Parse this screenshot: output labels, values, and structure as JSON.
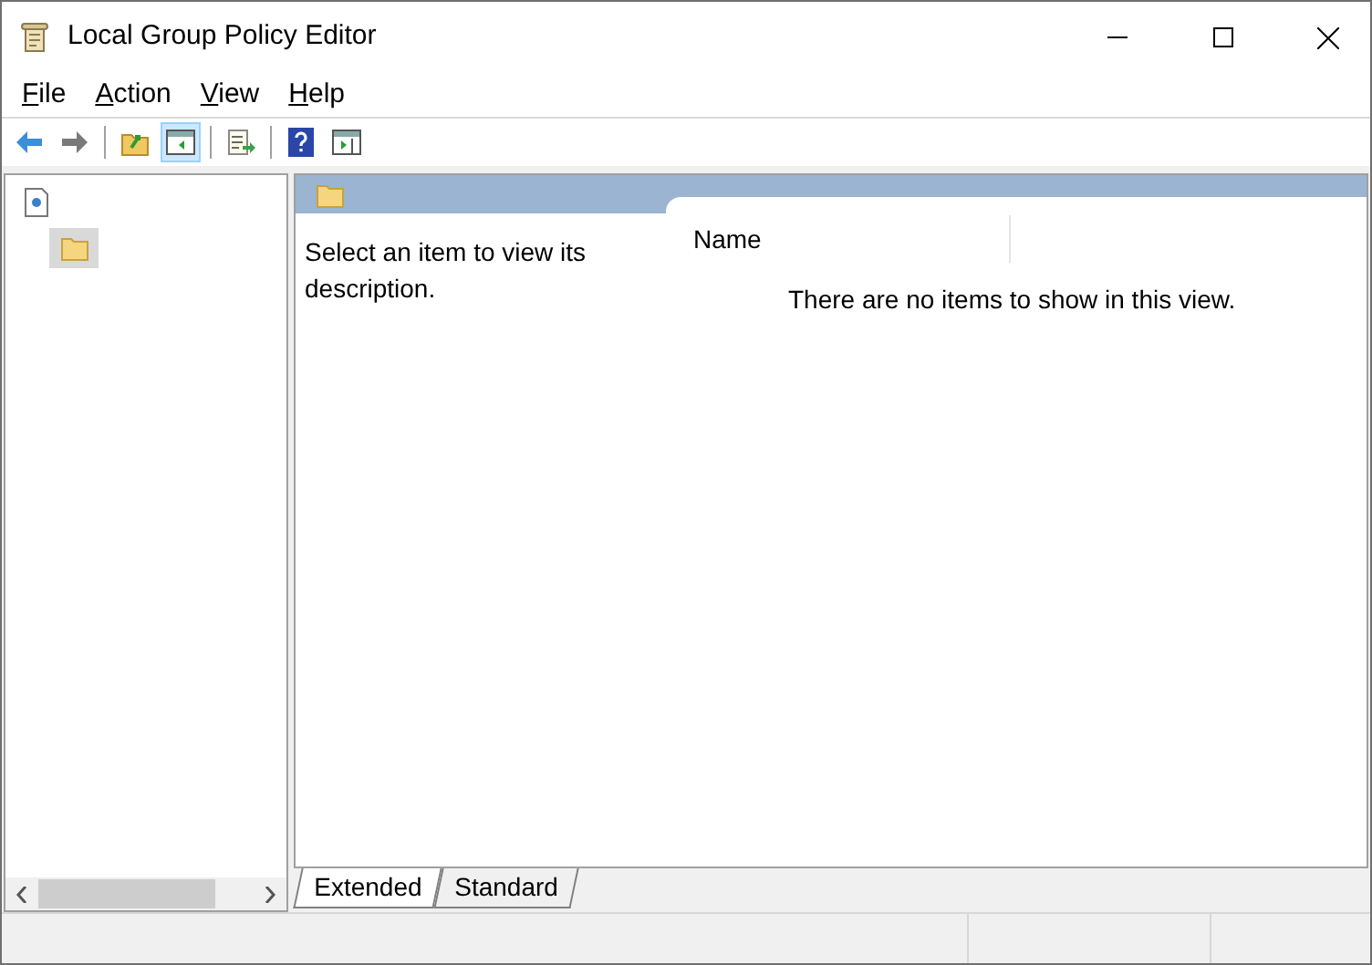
{
  "window": {
    "title": "Local Group Policy Editor"
  },
  "menu": [
    "File",
    "Action",
    "View",
    "Help"
  ],
  "toolbar": [
    {
      "kind": "back",
      "pressed": false
    },
    {
      "kind": "forward",
      "pressed": false
    },
    {
      "kind": "separator"
    },
    {
      "kind": "up",
      "pressed": false
    },
    {
      "kind": "tree-toggle",
      "pressed": true
    },
    {
      "kind": "separator"
    },
    {
      "kind": "export",
      "pressed": false
    },
    {
      "kind": "separator"
    },
    {
      "kind": "help",
      "pressed": false
    },
    {
      "kind": "action-pane",
      "pressed": false
    }
  ],
  "tree": [
    {
      "kind": "document",
      "selected": false,
      "children": [
        {
          "kind": "folder",
          "selected": true
        }
      ]
    }
  ],
  "description": "Select an item to view its description.",
  "list": {
    "columns": [
      "Name"
    ],
    "empty_message": "There are no items to show in this view."
  },
  "tabs": [
    {
      "label": "Extended",
      "selected": true
    },
    {
      "label": "Standard",
      "selected": false
    }
  ]
}
